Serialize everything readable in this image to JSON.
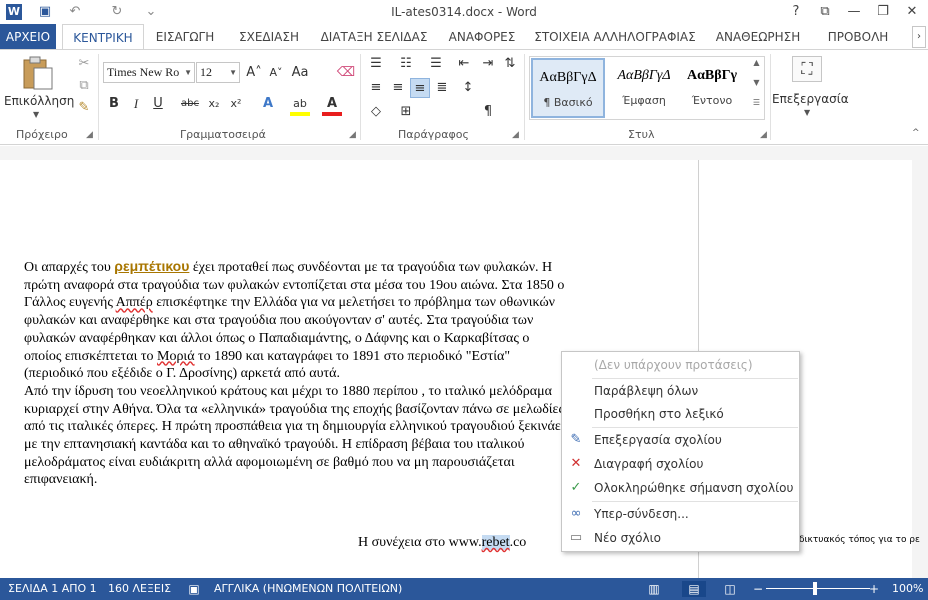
{
  "titlebar": {
    "title": "IL-ates0314.docx - Word",
    "minimize": "—",
    "restore": "❐",
    "close": "✕",
    "help": "?",
    "ribbon_display": "⧉"
  },
  "qat": {
    "app_icon": "W",
    "save_icon": "▣",
    "undo_icon": "↶",
    "redo_icon": "↻",
    "customize_icon": "⌄"
  },
  "tabs": [
    {
      "label": "ΑΡΧΕΙΟ"
    },
    {
      "label": "ΚΕΝΤΡΙΚΗ"
    },
    {
      "label": "ΕΙΣΑΓΩΓΗ"
    },
    {
      "label": "ΣΧΕΔΙΑΣΗ"
    },
    {
      "label": "ΔΙΑΤΑΞΗ ΣΕΛΙΔΑΣ"
    },
    {
      "label": "ΑΝΑΦΟΡΕΣ"
    },
    {
      "label": "ΣΤΟΙΧΕΙΑ ΑΛΛΗΛΟΓΡΑΦΙΑΣ"
    },
    {
      "label": "ΑΝΑΘΕΩΡΗΣΗ"
    },
    {
      "label": "ΠΡΟΒΟΛΗ"
    }
  ],
  "ribbon": {
    "clipboard": {
      "paste_label": "Επικόλληση",
      "group_label": "Πρόχειρο"
    },
    "font": {
      "font_name": "Times New Ro",
      "font_size": "12",
      "group_label": "Γραμματοσειρά",
      "bold": "B",
      "italic": "I",
      "underline": "U",
      "strike": "abc",
      "sub": "x₂",
      "sup": "x²",
      "grow": "A˄",
      "shrink": "A˅",
      "case": "Aa",
      "effects": "A",
      "highlight": "ab",
      "color": "A"
    },
    "paragraph": {
      "group_label": "Παράγραφος"
    },
    "styles": {
      "group_label": "Στυλ",
      "items": [
        {
          "sample": "ΑαΒβΓγΔ",
          "name": "¶ Βασικό"
        },
        {
          "sample": "ΑαΒβΓγΔ",
          "name": "Έμφαση"
        },
        {
          "sample": "ΑαΒβΓγ",
          "name": "Έντονο"
        }
      ]
    },
    "editing": {
      "label": "Επεξεργασία"
    }
  },
  "document": {
    "para1_a": "Οι απαρχές του ",
    "para1_link": "ρεμπέτικου",
    "para1_b": " έχει προταθεί πως συνδέονται με τα τραγούδια των φυλακών. Η πρώτη αναφορά στα τραγούδια των φυλακών εντοπίζεται στα μέσα του 19ου αιώνα. Στα 1850 ο Γάλλος ευγενής ",
    "para1_appr": "Αππέρ",
    "para1_c": " επισκέφτηκε την Ελλάδα για να μελετήσει το πρόβλημα των οθωνικών φυλακών και αναφέρθηκε και στα τραγούδια που ακούγονταν σ' αυτές. Στα τραγούδια των φυλακών αναφέρθηκαν και άλλοι όπως ο Παπαδιαμάντης, ο Δάφνης και ο Καρκαβίτσας ο οποίος επισκέπτεται  το ",
    "para1_moria": "Μοριά",
    "para1_d": " το 1890 και καταγράφει το 1891 στο περιοδικό  \"Εστία\" (περιοδικό που εξέδιδε ο Γ. Δροσίνης) αρκετά από αυτά.",
    "para2": "Από την ίδρυση του νεοελληνικού κράτους και μέχρι το 1880 περίπου , το ιταλικό μελόδραμα κυριαρχεί στην Αθήνα.  Όλα τα «ελληνικά» τραγούδια της εποχής βασίζονταν πάνω σε μελωδίες από τις ιταλικές όπερες. Η πρώτη προσπάθεια για τη δημιουργία ελληνικού τραγουδιού ξεκινάει με την επτανησιακή καντάδα και το αθηναϊκό τραγούδι. Η επίδραση βέβαια του ιταλικού μελοδράματος είναι ευδιάκριτη αλλά αφομοιωμένη σε βαθμό που να μη παρουσιάζεται επιφανειακή.",
    "continue_a": "Η συνέχεια στο   www.",
    "continue_sel": "rebet",
    "continue_b": ".co",
    "comment_snip": "δικτυακός τόπος για το ρε"
  },
  "context_menu": {
    "no_suggestions": "(Δεν υπάρχουν προτάσεις)",
    "ignore_all": "Παράβλεψη όλων",
    "add_dictionary": "Προσθήκη στο λεξικό",
    "edit_comment": "Επεξεργασία σχολίου",
    "delete_comment": "Διαγραφή σχολίου",
    "mark_done": "Ολοκληρώθηκε σήμανση σχολίου",
    "hyperlink": "Υπερ-σύνδεση...",
    "new_comment": "Νέο σχόλιο"
  },
  "status": {
    "page": "ΣΕΛΙΔΑ 1 ΑΠΟ 1",
    "words": "160 ΛΕΞΕΙΣ",
    "language": "ΑΓΓΛΙΚΑ (ΗΝΩΜΕΝΩΝ ΠΟΛΙΤΕΙΩΝ)",
    "zoom": "100%",
    "zoom_minus": "−",
    "zoom_plus": "+"
  }
}
